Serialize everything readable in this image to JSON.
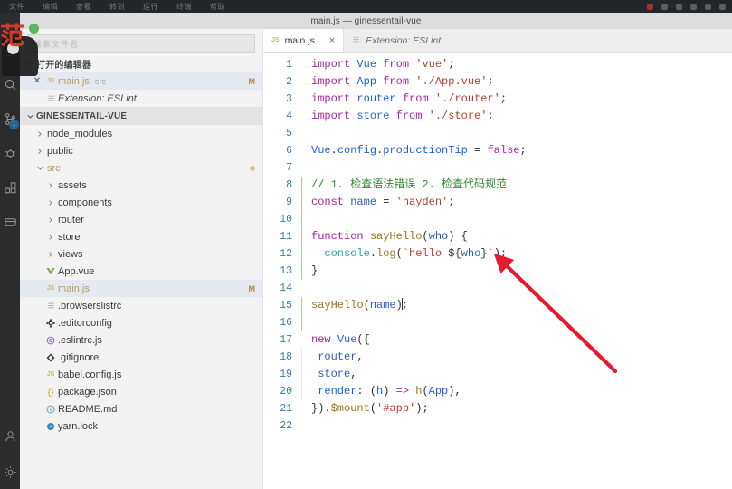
{
  "os_menubar": {
    "items": [
      "文件",
      "编辑",
      "查看",
      "转到",
      "运行",
      "终端",
      "帮助"
    ],
    "tray_icons": [
      "record-indicator",
      "battery-icon",
      "wifi-icon",
      "volume-icon",
      "clock-icon",
      "user-icon"
    ]
  },
  "titlebar": {
    "title": "main.js — ginessentail-vue"
  },
  "activity_bar": {
    "items": [
      {
        "name": "explorer",
        "icon": "files-icon",
        "badge": ""
      },
      {
        "name": "search",
        "icon": "search-icon",
        "badge": ""
      },
      {
        "name": "source-control",
        "icon": "source-control-icon",
        "badge": "1"
      },
      {
        "name": "run-and-debug",
        "icon": "debug-icon",
        "badge": ""
      },
      {
        "name": "extensions",
        "icon": "extensions-icon",
        "badge": ""
      },
      {
        "name": "remote-explorer",
        "icon": "remote-icon",
        "badge": ""
      }
    ],
    "bottom": [
      {
        "name": "accounts",
        "icon": "account-icon"
      },
      {
        "name": "settings",
        "icon": "gear-icon"
      }
    ]
  },
  "sidebar": {
    "filter_placeholder": "搜索文件名",
    "open_editors": {
      "title": "打开的编辑器",
      "chevron": "chevron-down-icon",
      "items": [
        {
          "label": "main.js",
          "sub": "src",
          "badge": "M",
          "icon": "js-file-icon",
          "close": "close-icon",
          "selected": true,
          "italic": false
        },
        {
          "label": "Extension: ESLint",
          "sub": "",
          "badge": "",
          "icon": "preview-icon",
          "close": "",
          "selected": false,
          "italic": true
        }
      ]
    },
    "project": {
      "title": "GINESSENTAIL-VUE",
      "chevron": "chevron-down-icon",
      "items": [
        {
          "label": "node_modules",
          "type": "folder",
          "icon": "chevron-right-icon",
          "depth": 1,
          "badge": "",
          "dot": false,
          "selected": false
        },
        {
          "label": "public",
          "type": "folder",
          "icon": "chevron-right-icon",
          "depth": 1,
          "badge": "",
          "dot": false,
          "selected": false
        },
        {
          "label": "src",
          "type": "folder-open",
          "icon": "chevron-down-icon",
          "depth": 1,
          "badge": "",
          "dot": true,
          "selected": false
        },
        {
          "label": "assets",
          "type": "folder",
          "icon": "chevron-right-icon",
          "depth": 2,
          "badge": "",
          "dot": false,
          "selected": false
        },
        {
          "label": "components",
          "type": "folder",
          "icon": "chevron-right-icon",
          "depth": 2,
          "badge": "",
          "dot": false,
          "selected": false
        },
        {
          "label": "router",
          "type": "folder",
          "icon": "chevron-right-icon",
          "depth": 2,
          "badge": "",
          "dot": false,
          "selected": false
        },
        {
          "label": "store",
          "type": "folder",
          "icon": "chevron-right-icon",
          "depth": 2,
          "badge": "",
          "dot": false,
          "selected": false
        },
        {
          "label": "views",
          "type": "folder",
          "icon": "chevron-right-icon",
          "depth": 2,
          "badge": "",
          "dot": false,
          "selected": false
        },
        {
          "label": "App.vue",
          "type": "file",
          "icon": "vue-file-icon",
          "depth": 2,
          "badge": "",
          "dot": false,
          "selected": false
        },
        {
          "label": "main.js",
          "type": "file",
          "icon": "js-file-icon",
          "depth": 2,
          "badge": "M",
          "dot": false,
          "selected": true
        },
        {
          "label": ".browserslistrc",
          "type": "file",
          "icon": "list-file-icon",
          "depth": 1,
          "badge": "",
          "dot": false,
          "selected": false
        },
        {
          "label": ".editorconfig",
          "type": "file",
          "icon": "gear-file-icon",
          "depth": 1,
          "badge": "",
          "dot": false,
          "selected": false
        },
        {
          "label": ".eslintrc.js",
          "type": "file",
          "icon": "eslint-file-icon",
          "depth": 1,
          "badge": "",
          "dot": false,
          "selected": false
        },
        {
          "label": ".gitignore",
          "type": "file",
          "icon": "git-file-icon",
          "depth": 1,
          "badge": "",
          "dot": false,
          "selected": false
        },
        {
          "label": "babel.config.js",
          "type": "file",
          "icon": "js-file-icon",
          "depth": 1,
          "badge": "",
          "dot": false,
          "selected": false
        },
        {
          "label": "package.json",
          "type": "file",
          "icon": "json-file-icon",
          "depth": 1,
          "badge": "",
          "dot": false,
          "selected": false
        },
        {
          "label": "README.md",
          "type": "file",
          "icon": "markdown-file-icon",
          "depth": 1,
          "badge": "",
          "dot": false,
          "selected": false
        },
        {
          "label": "yarn.lock",
          "type": "file",
          "icon": "yarn-file-icon",
          "depth": 1,
          "badge": "",
          "dot": false,
          "selected": false
        }
      ]
    }
  },
  "editor": {
    "tabs": [
      {
        "label": "main.js",
        "icon": "js-file-icon",
        "active": true,
        "italic": false,
        "close": "×"
      },
      {
        "label": "Extension: ESLint",
        "icon": "preview-icon",
        "active": false,
        "italic": true,
        "close": ""
      }
    ],
    "lines": [
      {
        "n": "1",
        "guide": "none"
      },
      {
        "n": "2",
        "guide": "none"
      },
      {
        "n": "3",
        "guide": "none"
      },
      {
        "n": "4",
        "guide": "none"
      },
      {
        "n": "5",
        "guide": "none"
      },
      {
        "n": "6",
        "guide": "none"
      },
      {
        "n": "7",
        "guide": "none"
      },
      {
        "n": "8",
        "guide": "green"
      },
      {
        "n": "9",
        "guide": "green"
      },
      {
        "n": "10",
        "guide": "green"
      },
      {
        "n": "11",
        "guide": "green"
      },
      {
        "n": "12",
        "guide": "green"
      },
      {
        "n": "13",
        "guide": "green"
      },
      {
        "n": "14",
        "guide": "none"
      },
      {
        "n": "15",
        "guide": "green"
      },
      {
        "n": "16",
        "guide": "green"
      },
      {
        "n": "17",
        "guide": "none"
      },
      {
        "n": "18",
        "guide": "gray"
      },
      {
        "n": "19",
        "guide": "gray"
      },
      {
        "n": "20",
        "guide": "gray"
      },
      {
        "n": "21",
        "guide": "none"
      },
      {
        "n": "22",
        "guide": "none"
      }
    ],
    "source_text": [
      "import Vue from 'vue';",
      "import App from './App.vue';",
      "import router from './router';",
      "import store from './store';",
      "",
      "Vue.config.productionTip = false;",
      "",
      "// 1. 检查语法错误 2. 检查代码规范",
      "const name = 'hayden';",
      "",
      "function sayHello(who) {",
      "  console.log(`hello ${who}`);",
      "}",
      "",
      "sayHello(name);",
      "",
      "new Vue({",
      "  router,",
      "  store,",
      "  render: (h) => h(App),",
      "}).$mount('#app');",
      ""
    ],
    "tokens": {
      "l1": [
        [
          "import",
          "t-kw"
        ],
        [
          " ",
          ""
        ],
        [
          "Vue",
          "t-id"
        ],
        [
          " ",
          ""
        ],
        [
          "from",
          "t-kw"
        ],
        [
          " ",
          ""
        ],
        [
          "'vue'",
          "t-str"
        ],
        [
          ";",
          "t-punct"
        ]
      ],
      "l2": [
        [
          "import",
          "t-kw"
        ],
        [
          " ",
          ""
        ],
        [
          "App",
          "t-id"
        ],
        [
          " ",
          ""
        ],
        [
          "from",
          "t-kw"
        ],
        [
          " ",
          ""
        ],
        [
          "'./App.vue'",
          "t-str"
        ],
        [
          ";",
          "t-punct"
        ]
      ],
      "l3": [
        [
          "import",
          "t-kw"
        ],
        [
          " ",
          ""
        ],
        [
          "router",
          "t-id"
        ],
        [
          " ",
          ""
        ],
        [
          "from",
          "t-kw"
        ],
        [
          " ",
          ""
        ],
        [
          "'./router'",
          "t-str"
        ],
        [
          ";",
          "t-punct"
        ]
      ],
      "l4": [
        [
          "import",
          "t-kw"
        ],
        [
          " ",
          ""
        ],
        [
          "store",
          "t-id"
        ],
        [
          " ",
          ""
        ],
        [
          "from",
          "t-kw"
        ],
        [
          " ",
          ""
        ],
        [
          "'./store'",
          "t-str"
        ],
        [
          ";",
          "t-punct"
        ]
      ],
      "l6": [
        [
          "Vue",
          "t-id"
        ],
        [
          ".",
          "t-punct"
        ],
        [
          "config",
          "t-prop"
        ],
        [
          ".",
          "t-punct"
        ],
        [
          "productionTip",
          "t-prop"
        ],
        [
          " = ",
          "t-punct"
        ],
        [
          "false",
          "t-kw"
        ],
        [
          ";",
          "t-punct"
        ]
      ],
      "l8": [
        [
          "// 1. 检查语法错误 2. 检查代码规范",
          "t-cmt"
        ]
      ],
      "l9": [
        [
          "const",
          "t-kw"
        ],
        [
          " ",
          ""
        ],
        [
          "name",
          "t-var"
        ],
        [
          " = ",
          "t-punct"
        ],
        [
          "'hayden'",
          "t-str"
        ],
        [
          ";",
          "t-punct"
        ]
      ],
      "l11": [
        [
          "function",
          "t-kw"
        ],
        [
          " ",
          ""
        ],
        [
          "sayHello",
          "t-fn"
        ],
        [
          "(",
          "t-punct"
        ],
        [
          "who",
          "t-var"
        ],
        [
          ") {",
          "t-punct"
        ]
      ],
      "l12": [
        [
          "  ",
          ""
        ],
        [
          "console",
          "t-obj"
        ],
        [
          ".",
          "t-punct"
        ],
        [
          "log",
          "t-fn"
        ],
        [
          "(",
          "t-punct"
        ],
        [
          "`hello ",
          "t-str"
        ],
        [
          "${",
          "t-punct"
        ],
        [
          "who",
          "t-var"
        ],
        [
          "}",
          "t-punct"
        ],
        [
          "`",
          "t-str"
        ],
        [
          ");",
          "t-punct"
        ]
      ],
      "l13": [
        [
          "}",
          "t-punct"
        ]
      ],
      "l15": [
        [
          "sayHello",
          "t-fn"
        ],
        [
          "(",
          "t-punct"
        ],
        [
          "name",
          "t-var"
        ],
        [
          ")",
          "t-punct"
        ],
        [
          ";",
          "t-punct"
        ]
      ],
      "l17": [
        [
          "new",
          "t-kw"
        ],
        [
          " ",
          ""
        ],
        [
          "Vue",
          "t-id"
        ],
        [
          "({",
          "t-punct"
        ]
      ],
      "l18": [
        [
          "  ",
          ""
        ],
        [
          "router",
          "t-var"
        ],
        [
          ",",
          "t-punct"
        ]
      ],
      "l19": [
        [
          "  ",
          ""
        ],
        [
          "store",
          "t-var"
        ],
        [
          ",",
          "t-punct"
        ]
      ],
      "l20": [
        [
          "  ",
          ""
        ],
        [
          "render",
          "t-prop"
        ],
        [
          ": (",
          "t-punct"
        ],
        [
          "h",
          "t-var"
        ],
        [
          ") ",
          "t-punct"
        ],
        [
          "=>",
          "t-kw"
        ],
        [
          " ",
          ""
        ],
        [
          "h",
          "t-fn"
        ],
        [
          "(",
          "t-punct"
        ],
        [
          "App",
          "t-id"
        ],
        [
          "),",
          "t-punct"
        ]
      ],
      "l21": [
        [
          "}).",
          "t-punct"
        ],
        [
          "$mount",
          "t-fn"
        ],
        [
          "(",
          "t-punct"
        ],
        [
          "'#app'",
          "t-str"
        ],
        [
          ");",
          "t-punct"
        ]
      ]
    }
  },
  "annotation": {
    "arrow": {
      "name": "red-arrow-annotation",
      "color": "#e8192c"
    }
  },
  "watermark": {
    "text": "范",
    "icons": [
      "avatar-blob",
      "green-status-dot"
    ]
  },
  "colors": {
    "editor_bg": "#ffffff",
    "sidebar_bg": "#f3f3f3",
    "activitybar_bg": "#2c2c2c",
    "titlebar_bg": "#dddddd",
    "tabbar_bg": "#ececec",
    "selection_blue": "#e4e9f1",
    "accent_red": "#e8192c",
    "badge_blue": "#1f8ad2"
  }
}
